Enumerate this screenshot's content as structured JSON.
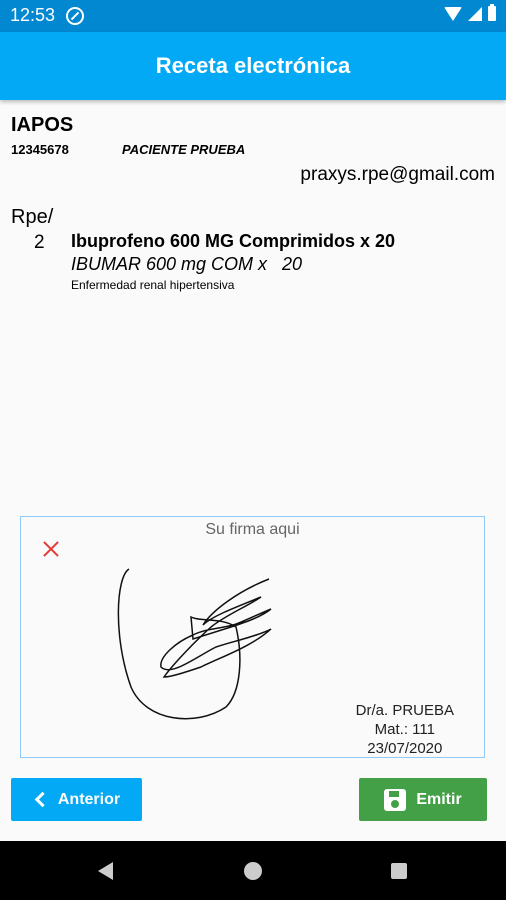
{
  "status_bar": {
    "time": "12:53"
  },
  "app_bar": {
    "title": "Receta electrónica"
  },
  "prescription": {
    "insurer": "IAPOS",
    "patient_id": "12345678",
    "patient_name": "PACIENTE PRUEBA",
    "email": "praxys.rpe@gmail.com",
    "rpe_label": "Rpe/",
    "rpe_number": "2",
    "drug_name": "Ibuprofeno 600 MG Comprimidos x 20",
    "drug_brand": "IBUMAR 600 mg COM x   20",
    "diagnosis": "Enfermedad renal hipertensiva"
  },
  "signature": {
    "placeholder": "Su firma aqui",
    "doctor_name": "Dr/a. PRUEBA",
    "license": "Mat.: 111",
    "date": "23/07/2020"
  },
  "buttons": {
    "previous": "Anterior",
    "emit": "Emitir"
  },
  "colors": {
    "primary": "#03a9f4",
    "primary_dark": "#0288d1",
    "success": "#43a047",
    "danger": "#e53935"
  }
}
